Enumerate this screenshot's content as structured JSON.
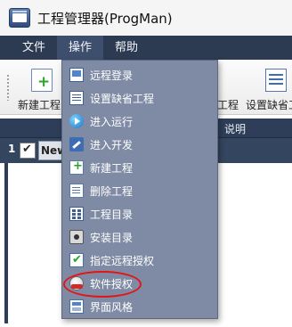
{
  "window": {
    "title": "工程管理器(ProgMan)"
  },
  "menubar": [
    {
      "label": "文件"
    },
    {
      "label": "操作"
    },
    {
      "label": "帮助"
    }
  ],
  "toolbar": {
    "new_project_label": "新建工程",
    "right_partial_label": "工程",
    "set_default_label": "设置缺省工"
  },
  "grid": {
    "header_col_desc": "说明",
    "row_number": "1",
    "row_name_value": "New"
  },
  "dropdown": {
    "items": [
      {
        "label": "远程登录",
        "icon": "remote-login-icon"
      },
      {
        "label": "设置缺省工程",
        "icon": "set-default-project-icon"
      },
      {
        "label": "进入运行",
        "icon": "run-icon"
      },
      {
        "label": "进入开发",
        "icon": "develop-icon"
      },
      {
        "label": "新建工程",
        "icon": "new-project-icon"
      },
      {
        "label": "删除工程",
        "icon": "delete-project-icon"
      },
      {
        "label": "工程目录",
        "icon": "project-directory-icon"
      },
      {
        "label": "安装目录",
        "icon": "install-directory-icon"
      },
      {
        "label": "指定远程授权",
        "icon": "assign-remote-license-icon"
      },
      {
        "label": "软件授权",
        "icon": "software-license-icon"
      },
      {
        "label": "界面风格",
        "icon": "interface-style-icon"
      }
    ]
  },
  "colors": {
    "menubar_bg": "#2c3a52",
    "dropdown_bg": "#7f8ba4",
    "highlight_ellipse": "#e41414"
  }
}
